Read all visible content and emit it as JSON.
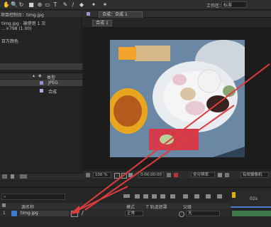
{
  "workspace": {
    "label": "工作区：",
    "value": "标准"
  },
  "viewer": {
    "tab_label": "合成：合成 1",
    "crumb": "合成 1",
    "zoom": "100 %",
    "timecode": "0:00:00:00",
    "resolution": "全分辨率",
    "view_label": "有效摄像机"
  },
  "project": {
    "panel_title": "项目控制台：timg.jpg",
    "file_name": "timg.jpg · 被使用 1 次",
    "file_info": "…×798 (1.00)",
    "file_extra": "百万颜色",
    "list_header": "类型",
    "items": [
      {
        "name": "",
        "type": "JPEG"
      },
      {
        "name": "",
        "type": "合成"
      }
    ]
  },
  "timeline": {
    "col_source": "源名称",
    "col_mode": "模式",
    "col_trkmat": "T 轨道遮罩",
    "col_parent": "父级",
    "layer_index": "1",
    "layer_name": "timg.jpg",
    "mode_value": "正常",
    "parent_value": "无",
    "ruler_label": "02s"
  },
  "colors": {
    "accent": "#e03c3c",
    "layer_bar": "#3f7a4b"
  }
}
